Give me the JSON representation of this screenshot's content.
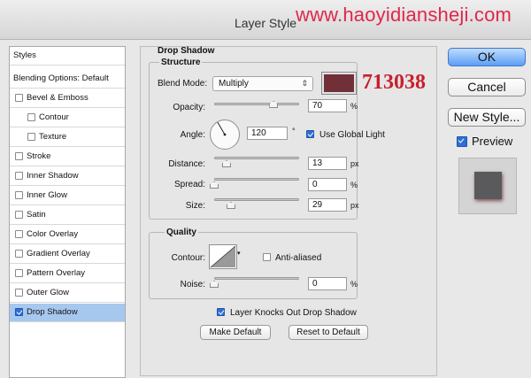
{
  "window": {
    "title": "Layer Style"
  },
  "watermark": "www.haoyidiansheji.com",
  "annotation": {
    "hex": "713038"
  },
  "colors": {
    "shadow": "#713038",
    "selection": "#a6c8ef",
    "ok_blue": "#5d9ef5",
    "annotation_red": "#c81f2e"
  },
  "sidebar": {
    "header": "Styles",
    "blending": "Blending Options: Default",
    "items": [
      {
        "label": "Bevel & Emboss",
        "checked": false
      },
      {
        "label": "Contour",
        "checked": false
      },
      {
        "label": "Texture",
        "checked": false
      },
      {
        "label": "Stroke",
        "checked": false
      },
      {
        "label": "Inner Shadow",
        "checked": false
      },
      {
        "label": "Inner Glow",
        "checked": false
      },
      {
        "label": "Satin",
        "checked": false
      },
      {
        "label": "Color Overlay",
        "checked": false
      },
      {
        "label": "Gradient Overlay",
        "checked": false
      },
      {
        "label": "Pattern Overlay",
        "checked": false
      },
      {
        "label": "Outer Glow",
        "checked": false
      },
      {
        "label": "Drop Shadow",
        "checked": true,
        "selected": true
      }
    ]
  },
  "drop_shadow": {
    "title": "Drop Shadow",
    "structure": {
      "title": "Structure",
      "blend_mode_label": "Blend Mode:",
      "blend_mode": "Multiply",
      "opacity_label": "Opacity:",
      "opacity": "70",
      "opacity_unit": "%",
      "opacity_pct": 70,
      "angle_label": "Angle:",
      "angle": "120",
      "angle_unit": "°",
      "use_global_light_label": "Use Global Light",
      "use_global_light": true,
      "distance_label": "Distance:",
      "distance": "13",
      "distance_unit": "px",
      "spread_label": "Spread:",
      "spread": "0",
      "spread_unit": "%",
      "size_label": "Size:",
      "size": "29",
      "size_unit": "px"
    },
    "quality": {
      "title": "Quality",
      "contour_label": "Contour:",
      "anti_aliased_label": "Anti-aliased",
      "anti_aliased": false,
      "noise_label": "Noise:",
      "noise": "0",
      "noise_unit": "%"
    },
    "knockout_label": "Layer Knocks Out Drop Shadow",
    "knockout": true,
    "make_default": "Make Default",
    "reset_default": "Reset to Default"
  },
  "buttons": {
    "ok": "OK",
    "cancel": "Cancel",
    "new_style": "New Style..."
  },
  "preview": {
    "label": "Preview",
    "checked": true
  }
}
